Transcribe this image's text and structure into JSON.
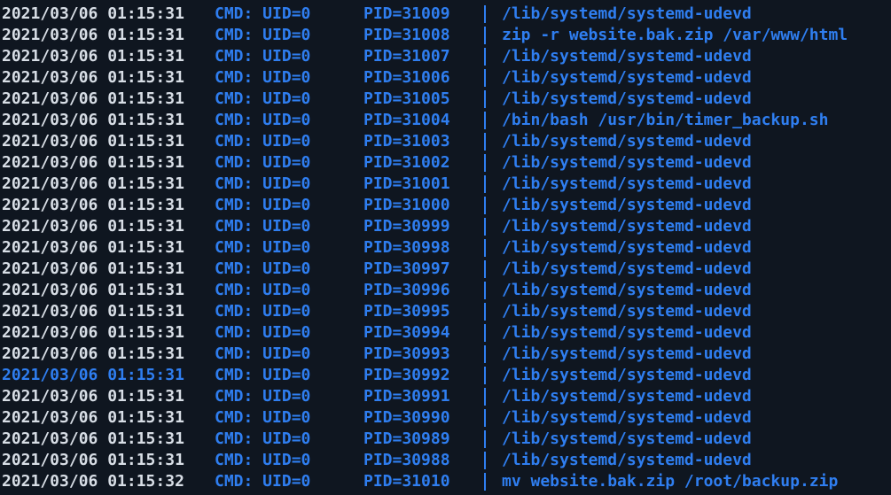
{
  "terminal": {
    "colors": {
      "background": "#0f1620",
      "text": "#d8dee6",
      "accent": "#2f7ef0"
    },
    "lines": [
      {
        "timestamp": "2021/03/06 01:15:31",
        "cmd": "CMD: UID=0",
        "pid": "PID=31009",
        "sep": "|",
        "command": "/lib/systemd/systemd-udevd",
        "selected": false
      },
      {
        "timestamp": "2021/03/06 01:15:31",
        "cmd": "CMD: UID=0",
        "pid": "PID=31008",
        "sep": "|",
        "command": "zip -r website.bak.zip /var/www/html",
        "selected": false
      },
      {
        "timestamp": "2021/03/06 01:15:31",
        "cmd": "CMD: UID=0",
        "pid": "PID=31007",
        "sep": "|",
        "command": "/lib/systemd/systemd-udevd",
        "selected": false
      },
      {
        "timestamp": "2021/03/06 01:15:31",
        "cmd": "CMD: UID=0",
        "pid": "PID=31006",
        "sep": "|",
        "command": "/lib/systemd/systemd-udevd",
        "selected": false
      },
      {
        "timestamp": "2021/03/06 01:15:31",
        "cmd": "CMD: UID=0",
        "pid": "PID=31005",
        "sep": "|",
        "command": "/lib/systemd/systemd-udevd",
        "selected": false
      },
      {
        "timestamp": "2021/03/06 01:15:31",
        "cmd": "CMD: UID=0",
        "pid": "PID=31004",
        "sep": "|",
        "command": "/bin/bash /usr/bin/timer_backup.sh",
        "selected": false
      },
      {
        "timestamp": "2021/03/06 01:15:31",
        "cmd": "CMD: UID=0",
        "pid": "PID=31003",
        "sep": "|",
        "command": "/lib/systemd/systemd-udevd",
        "selected": false
      },
      {
        "timestamp": "2021/03/06 01:15:31",
        "cmd": "CMD: UID=0",
        "pid": "PID=31002",
        "sep": "|",
        "command": "/lib/systemd/systemd-udevd",
        "selected": false
      },
      {
        "timestamp": "2021/03/06 01:15:31",
        "cmd": "CMD: UID=0",
        "pid": "PID=31001",
        "sep": "|",
        "command": "/lib/systemd/systemd-udevd",
        "selected": false
      },
      {
        "timestamp": "2021/03/06 01:15:31",
        "cmd": "CMD: UID=0",
        "pid": "PID=31000",
        "sep": "|",
        "command": "/lib/systemd/systemd-udevd",
        "selected": false
      },
      {
        "timestamp": "2021/03/06 01:15:31",
        "cmd": "CMD: UID=0",
        "pid": "PID=30999",
        "sep": "|",
        "command": "/lib/systemd/systemd-udevd",
        "selected": false
      },
      {
        "timestamp": "2021/03/06 01:15:31",
        "cmd": "CMD: UID=0",
        "pid": "PID=30998",
        "sep": "|",
        "command": "/lib/systemd/systemd-udevd",
        "selected": false
      },
      {
        "timestamp": "2021/03/06 01:15:31",
        "cmd": "CMD: UID=0",
        "pid": "PID=30997",
        "sep": "|",
        "command": "/lib/systemd/systemd-udevd",
        "selected": false
      },
      {
        "timestamp": "2021/03/06 01:15:31",
        "cmd": "CMD: UID=0",
        "pid": "PID=30996",
        "sep": "|",
        "command": "/lib/systemd/systemd-udevd",
        "selected": false
      },
      {
        "timestamp": "2021/03/06 01:15:31",
        "cmd": "CMD: UID=0",
        "pid": "PID=30995",
        "sep": "|",
        "command": "/lib/systemd/systemd-udevd",
        "selected": false
      },
      {
        "timestamp": "2021/03/06 01:15:31",
        "cmd": "CMD: UID=0",
        "pid": "PID=30994",
        "sep": "|",
        "command": "/lib/systemd/systemd-udevd",
        "selected": false
      },
      {
        "timestamp": "2021/03/06 01:15:31",
        "cmd": "CMD: UID=0",
        "pid": "PID=30993",
        "sep": "|",
        "command": "/lib/systemd/systemd-udevd",
        "selected": false
      },
      {
        "timestamp": "2021/03/06 01:15:31",
        "cmd": "CMD: UID=0",
        "pid": "PID=30992",
        "sep": "|",
        "command": "/lib/systemd/systemd-udevd",
        "selected": true
      },
      {
        "timestamp": "2021/03/06 01:15:31",
        "cmd": "CMD: UID=0",
        "pid": "PID=30991",
        "sep": "|",
        "command": "/lib/systemd/systemd-udevd",
        "selected": false
      },
      {
        "timestamp": "2021/03/06 01:15:31",
        "cmd": "CMD: UID=0",
        "pid": "PID=30990",
        "sep": "|",
        "command": "/lib/systemd/systemd-udevd",
        "selected": false
      },
      {
        "timestamp": "2021/03/06 01:15:31",
        "cmd": "CMD: UID=0",
        "pid": "PID=30989",
        "sep": "|",
        "command": "/lib/systemd/systemd-udevd",
        "selected": false
      },
      {
        "timestamp": "2021/03/06 01:15:31",
        "cmd": "CMD: UID=0",
        "pid": "PID=30988",
        "sep": "|",
        "command": "/lib/systemd/systemd-udevd",
        "selected": false
      },
      {
        "timestamp": "2021/03/06 01:15:32",
        "cmd": "CMD: UID=0",
        "pid": "PID=31010",
        "sep": "|",
        "command": "mv website.bak.zip /root/backup.zip",
        "selected": false
      }
    ]
  }
}
